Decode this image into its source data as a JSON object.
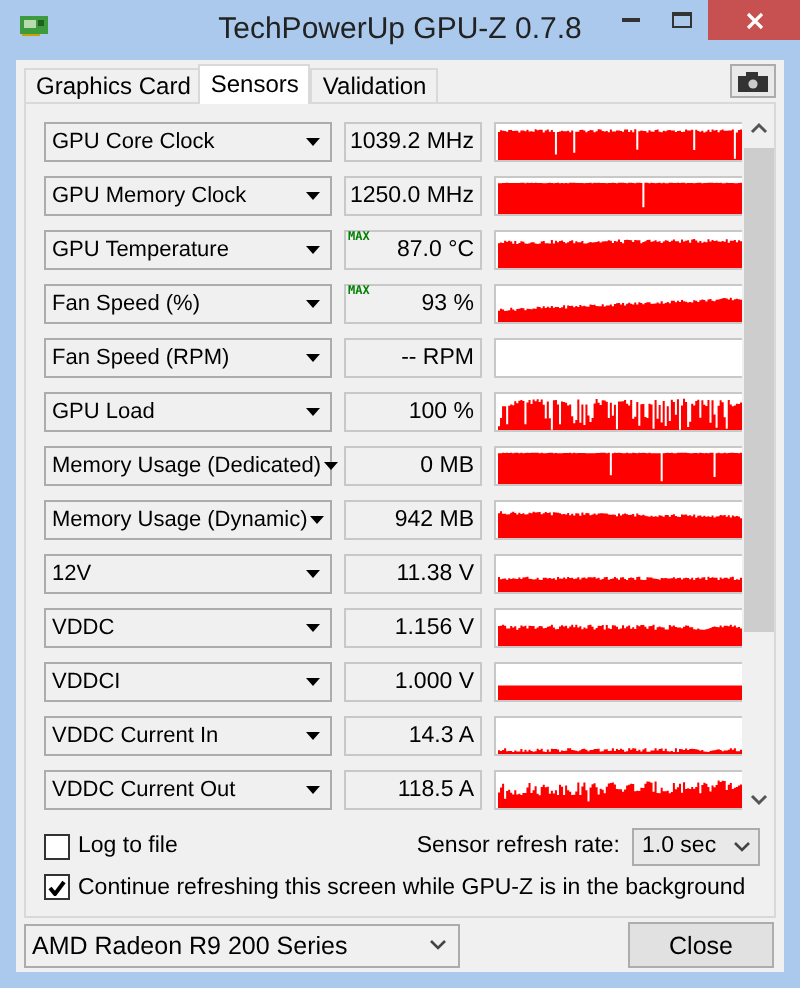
{
  "window": {
    "title": "TechPowerUp GPU-Z 0.7.8"
  },
  "tabs": [
    {
      "label": "Graphics Card",
      "selected": false
    },
    {
      "label": "Sensors",
      "selected": true
    },
    {
      "label": "Validation",
      "selected": false
    }
  ],
  "sensors": [
    {
      "name": "GPU Core Clock",
      "value": "1039.2 MHz",
      "kind": "high"
    },
    {
      "name": "GPU Memory Clock",
      "value": "1250.0 MHz",
      "kind": "full"
    },
    {
      "name": "GPU Temperature",
      "value": "87.0 °C",
      "flag": "MAX",
      "kind": "warm"
    },
    {
      "name": "Fan Speed (%)",
      "value": "93 %",
      "flag": "MAX",
      "kind": "ramp"
    },
    {
      "name": "Fan Speed (RPM)",
      "value": "-- RPM",
      "kind": "none"
    },
    {
      "name": "GPU Load",
      "value": "100 %",
      "kind": "bursty"
    },
    {
      "name": "Memory Usage (Dedicated)",
      "value": "0 MB",
      "kind": "full"
    },
    {
      "name": "Memory Usage (Dynamic)",
      "value": "942 MB",
      "kind": "step"
    },
    {
      "name": "12V",
      "value": "11.38 V",
      "kind": "low"
    },
    {
      "name": "VDDC",
      "value": "1.156 V",
      "kind": "mid"
    },
    {
      "name": "VDDCI",
      "value": "1.000 V",
      "kind": "flat"
    },
    {
      "name": "VDDC Current In",
      "value": "14.3 A",
      "kind": "tiny"
    },
    {
      "name": "VDDC Current Out",
      "value": "118.5 A",
      "kind": "jagged"
    }
  ],
  "log_to_file": {
    "label": "Log to file",
    "checked": false
  },
  "refresh_rate": {
    "label": "Sensor refresh rate:",
    "value": "1.0 sec"
  },
  "background_refresh": {
    "label": "Continue refreshing this screen while GPU-Z is in the background",
    "checked": true
  },
  "gpu_select": {
    "value": "AMD Radeon R9 200 Series"
  },
  "close_button": {
    "label": "Close"
  }
}
